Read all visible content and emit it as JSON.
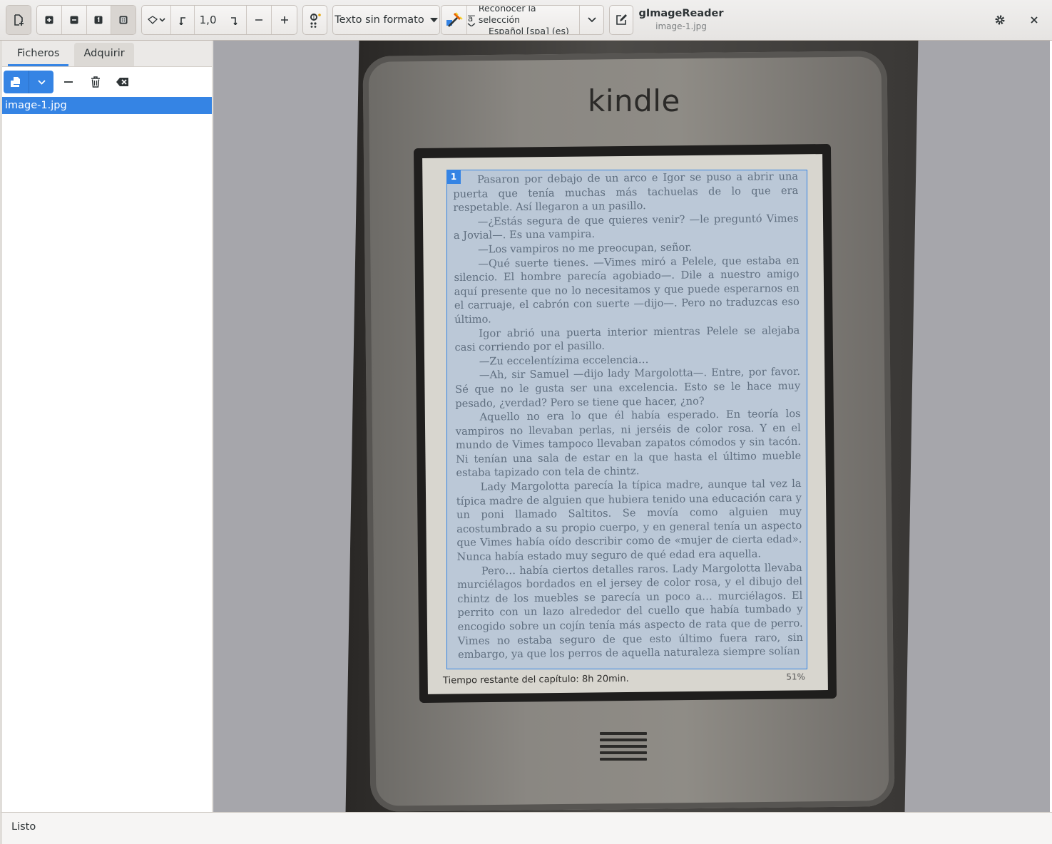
{
  "header": {
    "app_title": "gImageReader",
    "subtitle": "image-1.jpg",
    "zoom_value": "1,0",
    "output_mode_label": "Texto sin formato",
    "recognize_line1": "Reconocer la selección",
    "recognize_line2": "Español [spa] (es)",
    "accent_color": "#3584e4"
  },
  "sidebar": {
    "tabs": [
      {
        "label": "Ficheros",
        "active": true
      },
      {
        "label": "Adquirir",
        "active": false
      }
    ],
    "files": [
      {
        "name": "image-1.jpg",
        "selected": true
      }
    ]
  },
  "canvas": {
    "device_logo": "kindle",
    "selection_number": "1",
    "page_paragraphs": [
      "Pasaron por debajo de un arco e Igor se puso a abrir una puerta que tenía muchas más tachuelas de lo que era respetable. Así llegaron a un pasillo.",
      "—¿Estás segura de que quieres venir? —le preguntó Vimes a Jovial—. Es una vampira.",
      "—Los vampiros no me preocupan, señor.",
      "—Qué suerte tienes. —Vimes miró a Pelele, que estaba en silencio. El hombre parecía agobiado—. Dile a nuestro amigo aquí presente que no lo necesitamos y que puede esperarnos en el carruaje, el cabrón con suerte —dijo—. Pero no traduzcas eso último.",
      "Igor abrió una puerta interior mientras Pelele se alejaba casi corriendo por el pasillo.",
      "—Zu eccelentízima eccelencia…",
      "—Ah, sir Samuel —dijo lady Margolotta—. Entre, por favor. Sé que no le gusta ser una excelencia. Esto se le hace muy pesado, ¿verdad? Pero se tiene que hacer, ¿no?",
      "Aquello no era lo que él había esperado. En teoría los vampiros no llevaban perlas, ni jerséis de color rosa. Y en el mundo de Vimes tampoco llevaban zapatos cómodos y sin tacón. Ni tenían una sala de estar en la que hasta el último mueble estaba tapizado con tela de chintz.",
      "Lady Margolotta parecía la típica madre, aunque tal vez la típica madre de alguien que hubiera tenido una educación cara y un poni llamado Saltitos. Se movía como alguien muy acostumbrado a su propio cuerpo, y en general tenía un aspecto que Vimes había oído describir como de «mujer de cierta edad». Nunca había estado muy seguro de qué edad era aquella.",
      "Pero… había ciertos detalles raros. Lady Margolotta llevaba murciélagos bordados en el jersey de color rosa, y el dibujo del chintz de los muebles se parecía un poco a… murciélagos. El perrito con un lazo alrededor del cuello que había tumbado y encogido sobre un cojín tenía más aspecto de rata que de perro. Vimes no estaba seguro de que esto último fuera raro, sin embargo, ya que los perros de aquella naturaleza siempre solían"
    ],
    "footer_left": "Tiempo restante del capítulo: 8h 20min.",
    "footer_right": "51%"
  },
  "statusbar": {
    "text": "Listo"
  }
}
